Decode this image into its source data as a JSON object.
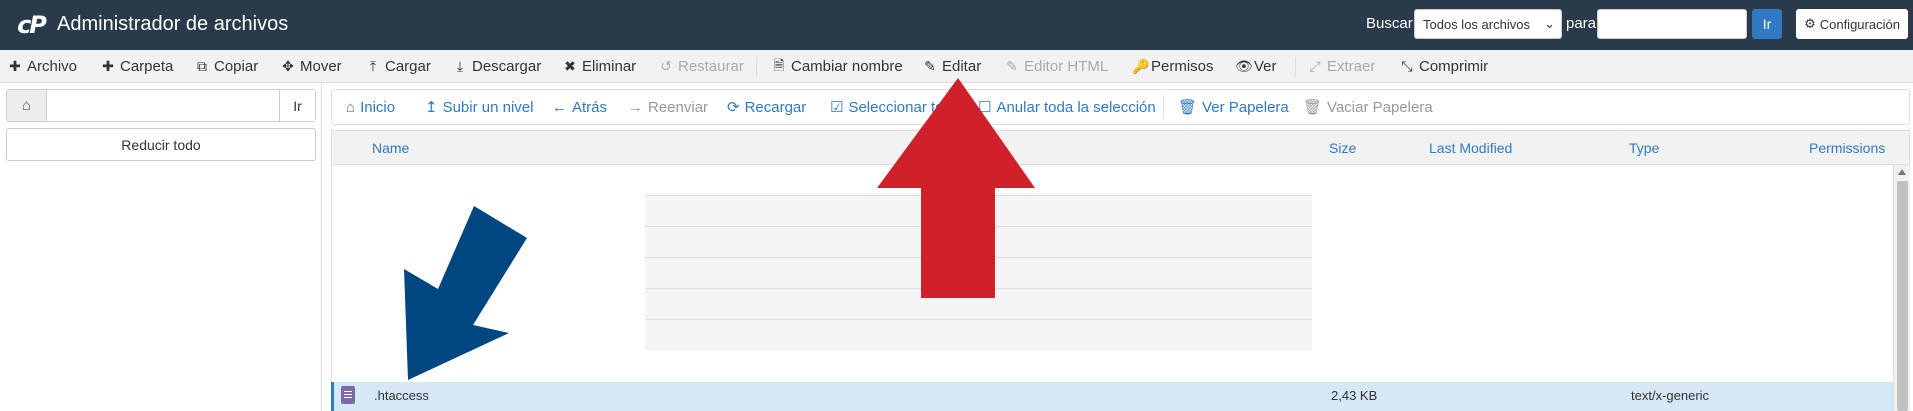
{
  "header": {
    "logo": "cP",
    "title": "Administrador de archivos",
    "search_label": "Buscar",
    "search_scope": "Todos los archivos",
    "para_label": "para",
    "search_value": "",
    "go_label": "Ir",
    "config_label": "Configuración"
  },
  "toolbar": {
    "archivo": "Archivo",
    "carpeta": "Carpeta",
    "copiar": "Copiar",
    "mover": "Mover",
    "cargar": "Cargar",
    "descargar": "Descargar",
    "eliminar": "Eliminar",
    "restaurar": "Restaurar",
    "cambiar_nombre": "Cambiar nombre",
    "editar": "Editar",
    "editor_html": "Editor HTML",
    "permisos": "Permisos",
    "ver": "Ver",
    "extraer": "Extraer",
    "comprimir": "Comprimir"
  },
  "tree": {
    "path_value": "",
    "go_label": "Ir",
    "collapse_label": "Reducir todo"
  },
  "nav": {
    "inicio": "Inicio",
    "subir": "Subir un nivel",
    "atras": "Atrás",
    "reenviar": "Reenviar",
    "recargar": "Recargar",
    "seleccionar": "Seleccionar to",
    "anular": "Anular toda la selección",
    "ver_papelera": "Ver Papelera",
    "vaciar_papelera": "Vaciar Papelera"
  },
  "table": {
    "columns": {
      "name": "Name",
      "size": "Size",
      "modified": "Last Modified",
      "type": "Type",
      "permissions": "Permissions"
    },
    "rows": [
      {
        "name": ".htaccess",
        "size": "2,43 KB",
        "type": "text/x-generic",
        "icon": "file-text-icon",
        "selected": true
      }
    ]
  },
  "annotations": {
    "red_arrow_color": "#d0202a",
    "blue_arrow_color": "#004680"
  },
  "colors": {
    "header_bg": "#293a4a",
    "accent": "#2f7ac0",
    "selected_row": "#d5e8f6"
  }
}
